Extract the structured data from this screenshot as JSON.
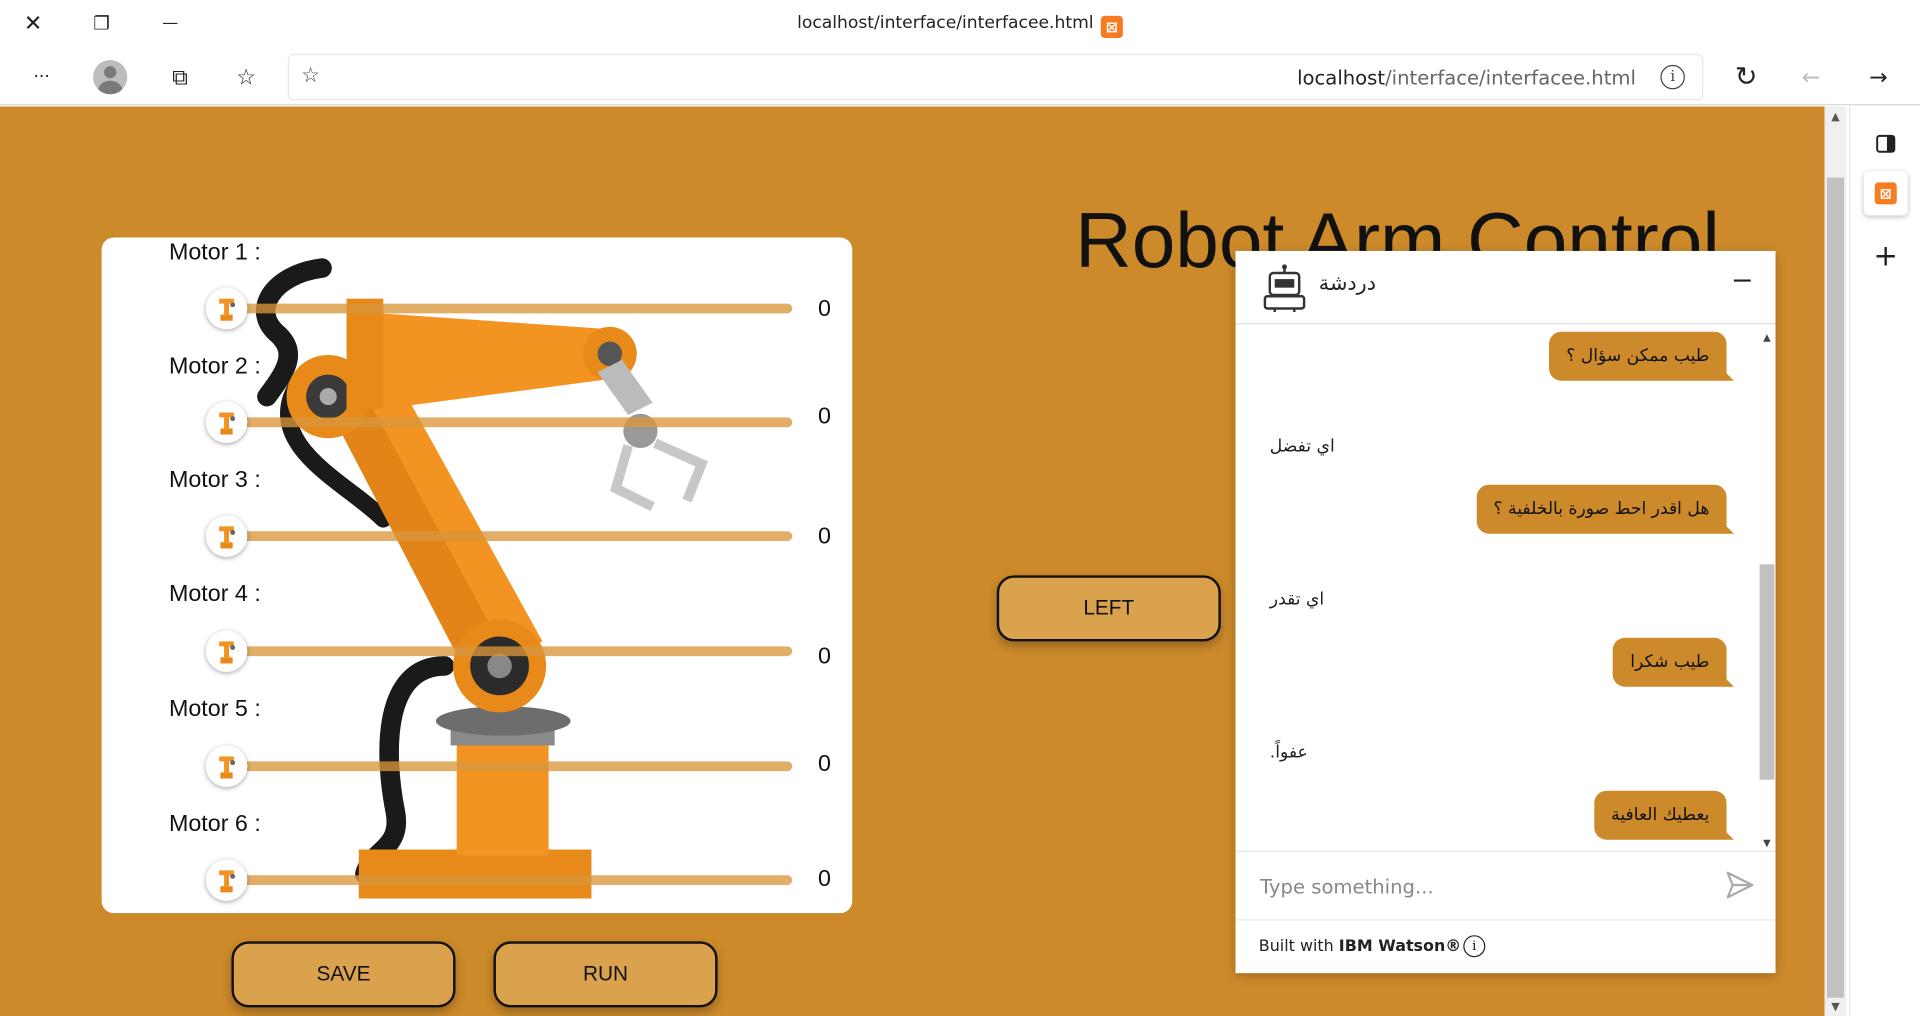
{
  "browser": {
    "tab_title": "localhost/interface/interfacee.html",
    "url_host": "localhost",
    "url_path": "/interface/interfacee.html",
    "icons": {
      "close": "✕",
      "restore": "❐",
      "minimize": "—",
      "more": "···",
      "collections": "⧉",
      "favorites": "☆",
      "refresh": "↻",
      "back": "←",
      "forward": "→",
      "add_favorite": "☆",
      "side_add": "+",
      "xampp": "⊠"
    }
  },
  "motors": [
    {
      "label": "Motor 1 :",
      "value": "0"
    },
    {
      "label": "Motor 2 :",
      "value": "0"
    },
    {
      "label": "Motor 3 :",
      "value": "0"
    },
    {
      "label": "Motor 4 :",
      "value": "0"
    },
    {
      "label": "Motor 5 :",
      "value": "0"
    },
    {
      "label": "Motor 6 :",
      "value": "0"
    }
  ],
  "buttons": {
    "save": "SAVE",
    "run": "RUN",
    "left": "LEFT"
  },
  "page_title": "Robot Arm Control",
  "chat": {
    "title": "دردشة",
    "minimize": "−",
    "messages": [
      {
        "from": "user",
        "text": "طيب ممكن سؤال ؟"
      },
      {
        "from": "bot",
        "text": "اي تفضل"
      },
      {
        "from": "user",
        "text": "هل اقدر احط صورة بالخلفية ؟"
      },
      {
        "from": "bot",
        "text": "اي تقدر"
      },
      {
        "from": "user",
        "text": "طيب شكرا"
      },
      {
        "from": "bot",
        "text": "عفواً."
      },
      {
        "from": "user",
        "text": "يعطيك العافية"
      }
    ],
    "input_placeholder": "Type something...",
    "footer_prefix": "Built with ",
    "footer_brand": "IBM Watson®",
    "footer_info": "i"
  },
  "colors": {
    "page_bg": "#cc8a2a",
    "button_bg": "#dba24e",
    "slider_track": "#d8963c",
    "bubble": "#cc8a2a"
  }
}
